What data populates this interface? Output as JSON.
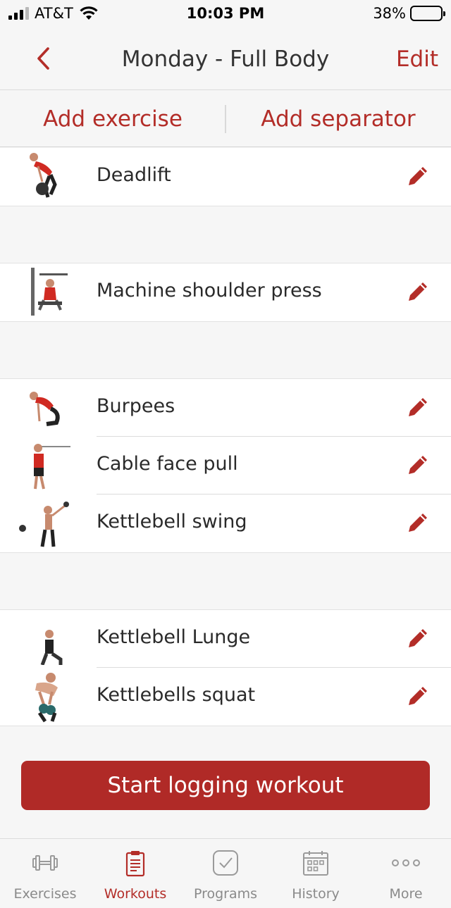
{
  "status_bar": {
    "carrier": "AT&T",
    "time": "10:03 PM",
    "battery": "38%",
    "battery_level": 0.38
  },
  "header": {
    "title": "Monday - Full Body",
    "edit_label": "Edit"
  },
  "actions": {
    "add_exercise": "Add exercise",
    "add_separator": "Add separator"
  },
  "groups": [
    {
      "exercises": [
        {
          "name": "Deadlift"
        }
      ]
    },
    {
      "exercises": [
        {
          "name": "Machine shoulder press"
        }
      ]
    },
    {
      "exercises": [
        {
          "name": "Burpees"
        },
        {
          "name": "Cable face pull"
        },
        {
          "name": "Kettlebell swing"
        }
      ]
    },
    {
      "exercises": [
        {
          "name": "Kettlebell Lunge"
        },
        {
          "name": "Kettlebells squat"
        }
      ]
    }
  ],
  "start_button": "Start logging workout",
  "tabs": [
    {
      "label": "Exercises",
      "icon": "dumbbell-icon"
    },
    {
      "label": "Workouts",
      "icon": "clipboard-icon",
      "active": true
    },
    {
      "label": "Programs",
      "icon": "checkbox-icon"
    },
    {
      "label": "History",
      "icon": "calendar-icon"
    },
    {
      "label": "More",
      "icon": "more-dots-icon"
    }
  ],
  "colors": {
    "accent": "#b32d28",
    "button": "#b02a27",
    "inactive": "#8a8a8a",
    "background": "#f6f6f6"
  }
}
